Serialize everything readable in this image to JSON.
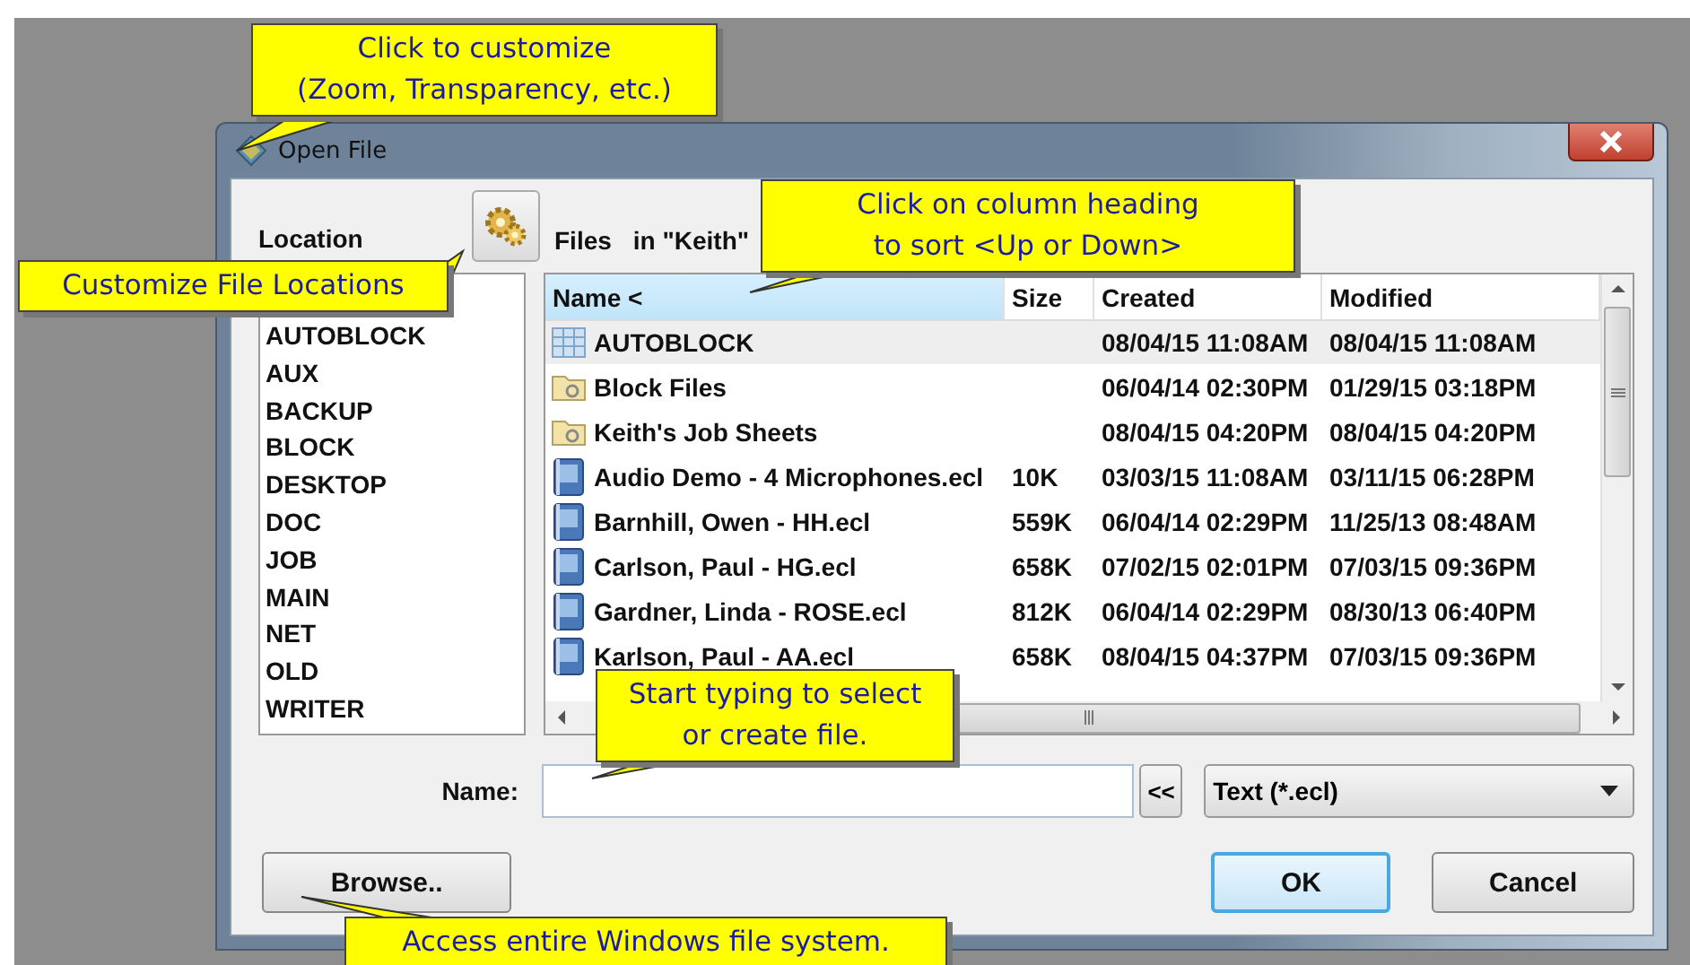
{
  "window": {
    "title": "Open File"
  },
  "location": {
    "label": "Location",
    "items": [
      "AUTOBLOCK",
      "AUX",
      "BACKUP",
      "BLOCK",
      "DESKTOP",
      "DOC",
      "JOB",
      "MAIN",
      "NET",
      "OLD",
      "WRITER"
    ]
  },
  "files": {
    "label": "Files",
    "folder": "in \"Keith\"",
    "columns": [
      {
        "label": "Name <",
        "sorted": true
      },
      {
        "label": "Size",
        "sorted": false
      },
      {
        "label": "Created",
        "sorted": false
      },
      {
        "label": "Modified",
        "sorted": false
      }
    ],
    "rows": [
      {
        "kind": "block",
        "name": "AUTOBLOCK",
        "size": "",
        "created": "08/04/15 11:08AM",
        "modified": "08/04/15 11:08AM",
        "selected": true
      },
      {
        "kind": "folder",
        "name": "Block Files",
        "size": "",
        "created": "06/04/14 02:30PM",
        "modified": "01/29/15 03:18PM",
        "selected": false
      },
      {
        "kind": "folder",
        "name": "Keith's Job Sheets",
        "size": "",
        "created": "08/04/15 04:20PM",
        "modified": "08/04/15 04:20PM",
        "selected": false
      },
      {
        "kind": "file",
        "name": "Audio Demo - 4 Microphones.ecl",
        "size": "10K",
        "created": "03/03/15 11:08AM",
        "modified": "03/11/15 06:28PM",
        "selected": false
      },
      {
        "kind": "file",
        "name": "Barnhill, Owen - HH.ecl",
        "size": "559K",
        "created": "06/04/14 02:29PM",
        "modified": "11/25/13 08:48AM",
        "selected": false
      },
      {
        "kind": "file",
        "name": "Carlson, Paul - HG.ecl",
        "size": "658K",
        "created": "07/02/15 02:01PM",
        "modified": "07/03/15 09:36PM",
        "selected": false
      },
      {
        "kind": "file",
        "name": "Gardner, Linda - ROSE.ecl",
        "size": "812K",
        "created": "06/04/14 02:29PM",
        "modified": "08/30/13 06:40PM",
        "selected": false
      },
      {
        "kind": "file",
        "name": "Karlson, Paul - AA.ecl",
        "size": "658K",
        "created": "08/04/15 04:37PM",
        "modified": "07/03/15 09:36PM",
        "selected": false
      }
    ]
  },
  "name_field": {
    "label": "Name:"
  },
  "recall_button": "<<",
  "file_type": "Text (*.ecl)",
  "buttons": [
    {
      "label": "Browse..",
      "default": false
    },
    {
      "label": "OK",
      "default": true
    },
    {
      "label": "Cancel",
      "default": false
    }
  ],
  "callouts": [
    {
      "lines": [
        "Click to customize",
        "(Zoom, Transparency, etc.)"
      ]
    },
    {
      "lines": [
        "Customize File Locations"
      ]
    },
    {
      "lines": [
        "Click on column heading",
        "to sort <Up or Down>"
      ]
    },
    {
      "lines": [
        "Start typing to select",
        "or create file."
      ]
    },
    {
      "lines": [
        "Access entire Windows file system."
      ]
    }
  ]
}
